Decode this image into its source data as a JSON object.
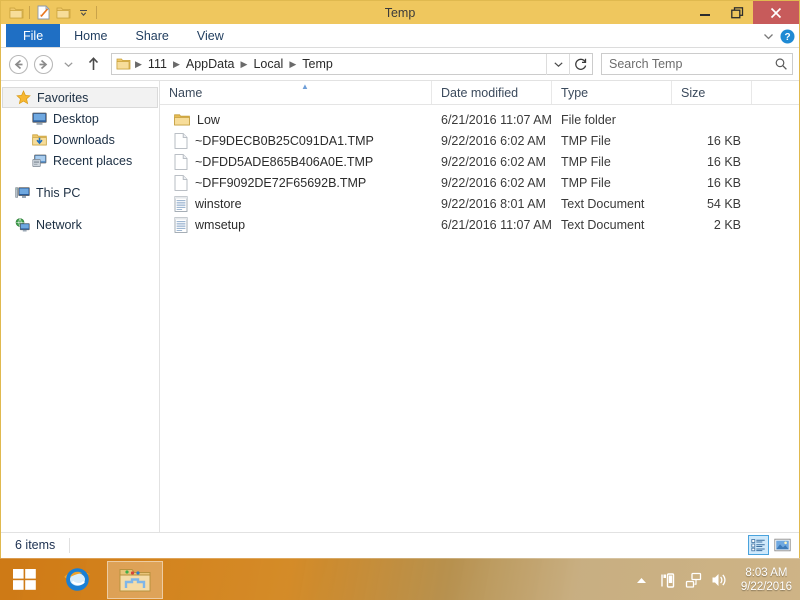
{
  "window": {
    "title": "Temp",
    "titlebar_color": "#efc75e",
    "close_color": "#c75b5b",
    "quick_access": [
      {
        "name": "folder-icon",
        "label": "Folder"
      },
      {
        "name": "properties-icon",
        "label": "Properties"
      },
      {
        "name": "new-folder-icon",
        "label": "New folder"
      },
      {
        "name": "chevron-down-icon",
        "label": "Customize Quick Access Toolbar"
      }
    ],
    "controls": {
      "minimize": "Minimize",
      "restore": "Restore",
      "close": "Close"
    }
  },
  "ribbon": {
    "tabs": [
      {
        "label": "File",
        "active": true
      },
      {
        "label": "Home",
        "active": false
      },
      {
        "label": "Share",
        "active": false
      },
      {
        "label": "View",
        "active": false
      }
    ],
    "expand_label": "Expand the Ribbon",
    "help_label": "Help"
  },
  "address": {
    "back_label": "Back",
    "forward_label": "Forward",
    "recent_label": "Recent locations",
    "up_label": "Up one level",
    "crumbs": [
      "111",
      "AppData",
      "Local",
      "Temp"
    ],
    "dropdown_label": "Previous locations",
    "refresh_label": "Refresh"
  },
  "search": {
    "placeholder": "Search Temp",
    "icon": "search-icon"
  },
  "sidebar": {
    "groups": [
      {
        "name": "Favorites",
        "icon": "star-icon",
        "selected": true,
        "items": [
          {
            "label": "Desktop",
            "icon": "desktop-icon"
          },
          {
            "label": "Downloads",
            "icon": "downloads-folder-icon"
          },
          {
            "label": "Recent places",
            "icon": "recent-places-icon"
          }
        ]
      },
      {
        "name": "This PC",
        "icon": "computer-icon",
        "selected": false,
        "items": []
      },
      {
        "name": "Network",
        "icon": "network-icon",
        "selected": false,
        "items": []
      }
    ]
  },
  "columns": [
    {
      "key": "name",
      "label": "Name",
      "sorted": "asc"
    },
    {
      "key": "date",
      "label": "Date modified",
      "sorted": null
    },
    {
      "key": "type",
      "label": "Type",
      "sorted": null
    },
    {
      "key": "size",
      "label": "Size",
      "sorted": null
    }
  ],
  "files": [
    {
      "name": "Low",
      "date": "6/21/2016 11:07 AM",
      "type": "File folder",
      "size": "",
      "icon": "folder-icon"
    },
    {
      "name": "~DF9DECB0B25C091DA1.TMP",
      "date": "9/22/2016 6:02 AM",
      "type": "TMP File",
      "size": "16 KB",
      "icon": "blank-file-icon"
    },
    {
      "name": "~DFDD5ADE865B406A0E.TMP",
      "date": "9/22/2016 6:02 AM",
      "type": "TMP File",
      "size": "16 KB",
      "icon": "blank-file-icon"
    },
    {
      "name": "~DFF9092DE72F65692B.TMP",
      "date": "9/22/2016 6:02 AM",
      "type": "TMP File",
      "size": "16 KB",
      "icon": "blank-file-icon"
    },
    {
      "name": "winstore",
      "date": "9/22/2016 8:01 AM",
      "type": "Text Document",
      "size": "54 KB",
      "icon": "text-document-icon"
    },
    {
      "name": "wmsetup",
      "date": "6/21/2016 11:07 AM",
      "type": "Text Document",
      "size": "2 KB",
      "icon": "text-document-icon"
    }
  ],
  "status": {
    "item_count": "6 items",
    "views": [
      {
        "name": "details-view-button",
        "label": "Details view",
        "active": true
      },
      {
        "name": "large-icons-view-button",
        "label": "Large icons view",
        "active": false
      }
    ]
  },
  "taskbar": {
    "start_label": "Start",
    "items": [
      {
        "name": "internet-explorer-taskbar-button",
        "label": "Internet Explorer",
        "active": false
      },
      {
        "name": "file-explorer-taskbar-button",
        "label": "File Explorer",
        "active": true
      }
    ],
    "tray": [
      {
        "name": "show-hidden-icons-button",
        "label": "Show hidden icons"
      },
      {
        "name": "flag-action-center-icon",
        "label": "Action Center"
      },
      {
        "name": "network-tray-icon",
        "label": "Network"
      },
      {
        "name": "volume-tray-icon",
        "label": "Speakers"
      }
    ],
    "clock": {
      "time": "8:03 AM",
      "date": "9/22/2016"
    }
  }
}
